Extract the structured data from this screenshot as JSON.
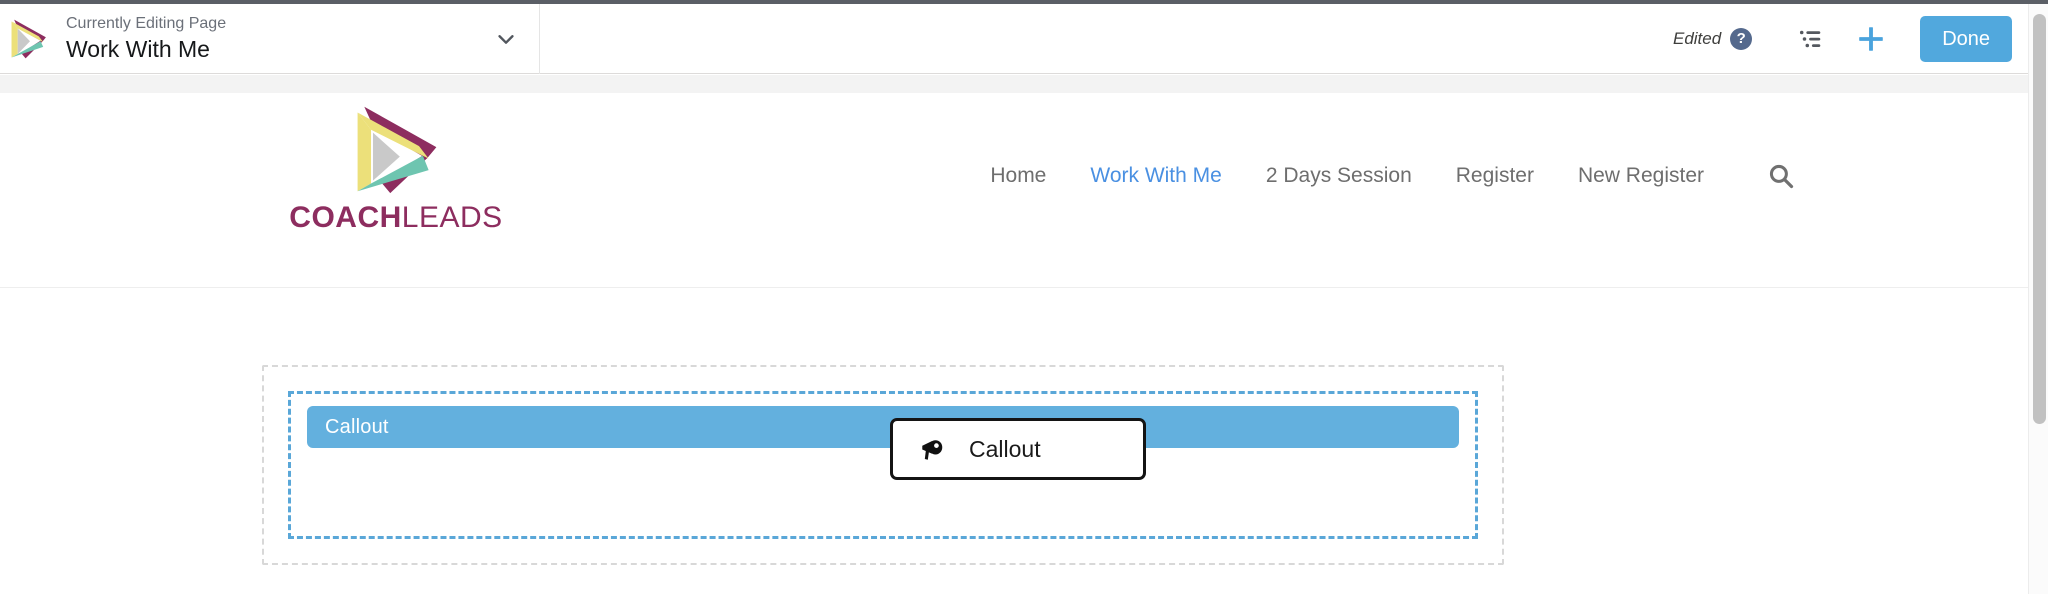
{
  "builder_header": {
    "brand_icon": "coachleads-triangle-icon",
    "eyebrow": "Currently Editing Page",
    "page_name": "Work With Me",
    "page_dropdown_icon": "chevron-down-icon",
    "status_label": "Edited",
    "help_icon": "help-question-icon",
    "help_glyph": "?",
    "outline_icon": "page-structure-list-icon",
    "add_icon": "plus-icon",
    "done_label": "Done",
    "accent_blue": "#51a8dd",
    "status_text_color": "#3e3e3c",
    "help_icon_color": "#54698d"
  },
  "site": {
    "logo": {
      "icon_name": "coachleads-impossible-triangle-logo",
      "word_bold": "COACH",
      "word_light": "LEADS",
      "color_purple": "#8d2d5f",
      "color_yellow": "#ece07a",
      "color_teal": "#6ec5b0",
      "color_gray": "#cccccc"
    },
    "nav": {
      "items": [
        {
          "label": "Home",
          "active": false
        },
        {
          "label": "Work With Me",
          "active": true
        },
        {
          "label": "2 Days Session",
          "active": false
        },
        {
          "label": "Register",
          "active": false
        },
        {
          "label": "New Register",
          "active": false
        }
      ],
      "search_icon": "search-icon",
      "active_color": "#4a90e2",
      "inactive_color": "#6e6e6e"
    }
  },
  "canvas": {
    "region_outer_name": "page-region-dropzone",
    "region_inner_name": "component-dropzone",
    "component": {
      "label": "Callout",
      "bar_color": "#63b0de",
      "label_color": "#ffffff"
    }
  },
  "drag_ghost": {
    "icon_name": "megaphone-icon",
    "label": "Callout",
    "border_color": "#141414"
  },
  "scrollbar": {
    "thumb_color": "#c1c1c1"
  }
}
